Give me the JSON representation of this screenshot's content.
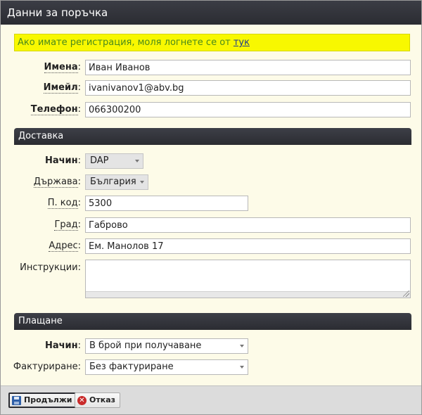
{
  "window": {
    "title": "Данни за поръчка"
  },
  "notice": {
    "text": "Ако имате регистрация, моля логнете се от ",
    "link": "тук"
  },
  "customer": {
    "name": {
      "label": "Имена",
      "value": "Иван Иванов"
    },
    "email": {
      "label": "Имейл",
      "value": "ivanivanov1@abv.bg"
    },
    "phone": {
      "label": "Телефон",
      "value": "066300200"
    }
  },
  "delivery": {
    "section_title": "Доставка",
    "method": {
      "label": "Начин",
      "value": "DAP"
    },
    "country": {
      "label": "Държава",
      "value": "България"
    },
    "postcode": {
      "label": "П. код",
      "value": "5300"
    },
    "city": {
      "label": "Град",
      "value": "Габрово"
    },
    "address": {
      "label": "Адрес",
      "value": "Ем. Манолов 17"
    },
    "instructions": {
      "label": "Инструкции",
      "value": ""
    }
  },
  "payment": {
    "section_title": "Плащане",
    "method": {
      "label": "Начин",
      "value": "В брой при получаване"
    },
    "invoicing": {
      "label": "Фактуриране",
      "value": "Без фактуриране"
    }
  },
  "footer": {
    "continue_label": "Продължи",
    "cancel_label": "Отказ"
  }
}
